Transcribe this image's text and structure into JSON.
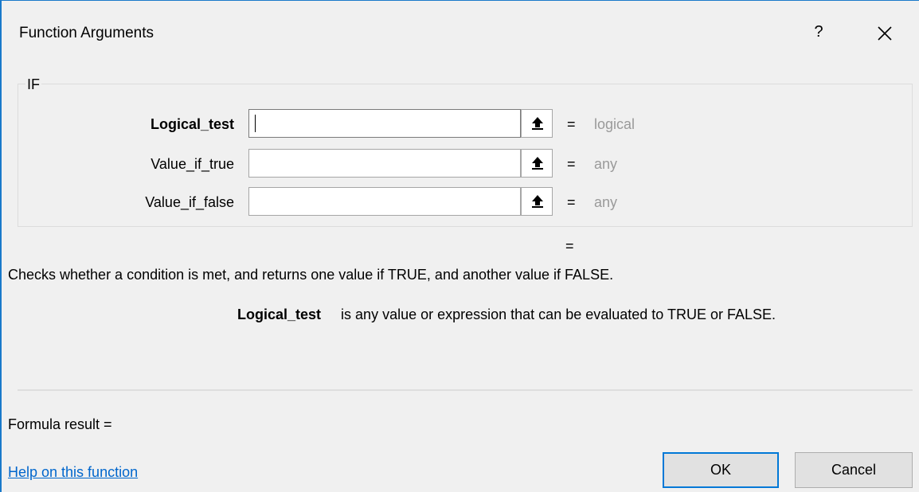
{
  "window": {
    "title": "Function Arguments",
    "help_glyph": "?"
  },
  "function": {
    "name": "IF",
    "arguments": [
      {
        "label": "Logical_test",
        "value": "",
        "result": "logical",
        "bold": true
      },
      {
        "label": "Value_if_true",
        "value": "",
        "result": "any",
        "bold": false
      },
      {
        "label": "Value_if_false",
        "value": "",
        "result": "any",
        "bold": false
      }
    ],
    "equals": "=",
    "result_equals": "=",
    "description": "Checks whether a condition is met, and returns one value if TRUE, and another value if FALSE.",
    "arg_help": {
      "name": "Logical_test",
      "text": "is any value or expression that can be evaluated to TRUE or FALSE."
    }
  },
  "footer": {
    "formula_result": "Formula result =",
    "help_link": "Help on this function",
    "ok": "OK",
    "cancel": "Cancel"
  },
  "icons": {
    "close": "close-icon",
    "collapse": "up-arrow-icon"
  },
  "colors": {
    "accent": "#0078d7",
    "link": "#0066cc",
    "muted": "#9a9a9a"
  }
}
